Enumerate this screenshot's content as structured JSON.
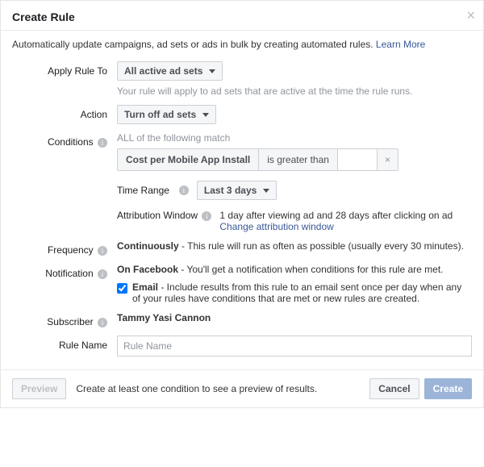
{
  "header": {
    "title": "Create Rule"
  },
  "intro": {
    "text": "Automatically update campaigns, ad sets or ads in bulk by creating automated rules. ",
    "learn_more": "Learn More"
  },
  "labels": {
    "apply_rule_to": "Apply Rule To",
    "action": "Action",
    "conditions": "Conditions",
    "frequency": "Frequency",
    "notification": "Notification",
    "subscriber": "Subscriber",
    "rule_name": "Rule Name"
  },
  "apply_rule": {
    "selected": "All active ad sets",
    "hint": "Your rule will apply to ad sets that are active at the time the rule runs."
  },
  "action": {
    "selected": "Turn off ad sets"
  },
  "conditions": {
    "match_text": "ALL of the following match",
    "metric": "Cost per Mobile App Install",
    "operator": "is greater than",
    "value": "",
    "time_range_label": "Time Range",
    "time_range_selected": "Last 3 days",
    "attr_label": "Attribution Window",
    "attr_value": "1 day after viewing ad and 28 days after clicking on ad",
    "attr_link": "Change attribution window"
  },
  "frequency": {
    "bold": "Continuously",
    "rest": " - This rule will run as often as possible (usually every 30 minutes)."
  },
  "notification": {
    "bold": "On Facebook",
    "rest": " - You'll get a notification when conditions for this rule are met.",
    "email_bold": "Email",
    "email_rest": " - Include results from this rule to an email sent once per day when any of your rules have conditions that are met or new rules are created."
  },
  "subscriber": {
    "name": "Tammy Yasi Cannon"
  },
  "rule_name": {
    "placeholder": "Rule Name"
  },
  "footer": {
    "preview": "Preview",
    "message": "Create at least one condition to see a preview of results.",
    "cancel": "Cancel",
    "create": "Create"
  }
}
